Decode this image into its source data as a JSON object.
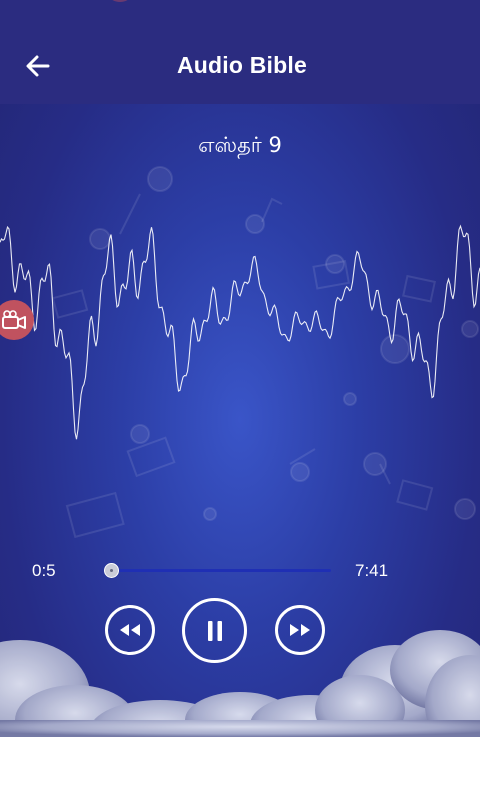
{
  "header": {
    "title": "Audio Bible",
    "back_icon": "arrow-left-icon"
  },
  "player": {
    "chapter": "எஸ்தர் 9",
    "current_time": "0:5",
    "total_time": "7:41",
    "progress": 0.01,
    "state": "playing"
  },
  "controls": {
    "rewind_icon": "rewind-icon",
    "pause_icon": "pause-icon",
    "forward_icon": "fast-forward-icon",
    "record_icon": "video-camera-icon"
  },
  "colors": {
    "appbar": "#2b2c80",
    "background": "#2c3ea6",
    "seek_track": "#1f2fb4",
    "record_button": "#c0525f",
    "foreground": "#ffffff"
  }
}
